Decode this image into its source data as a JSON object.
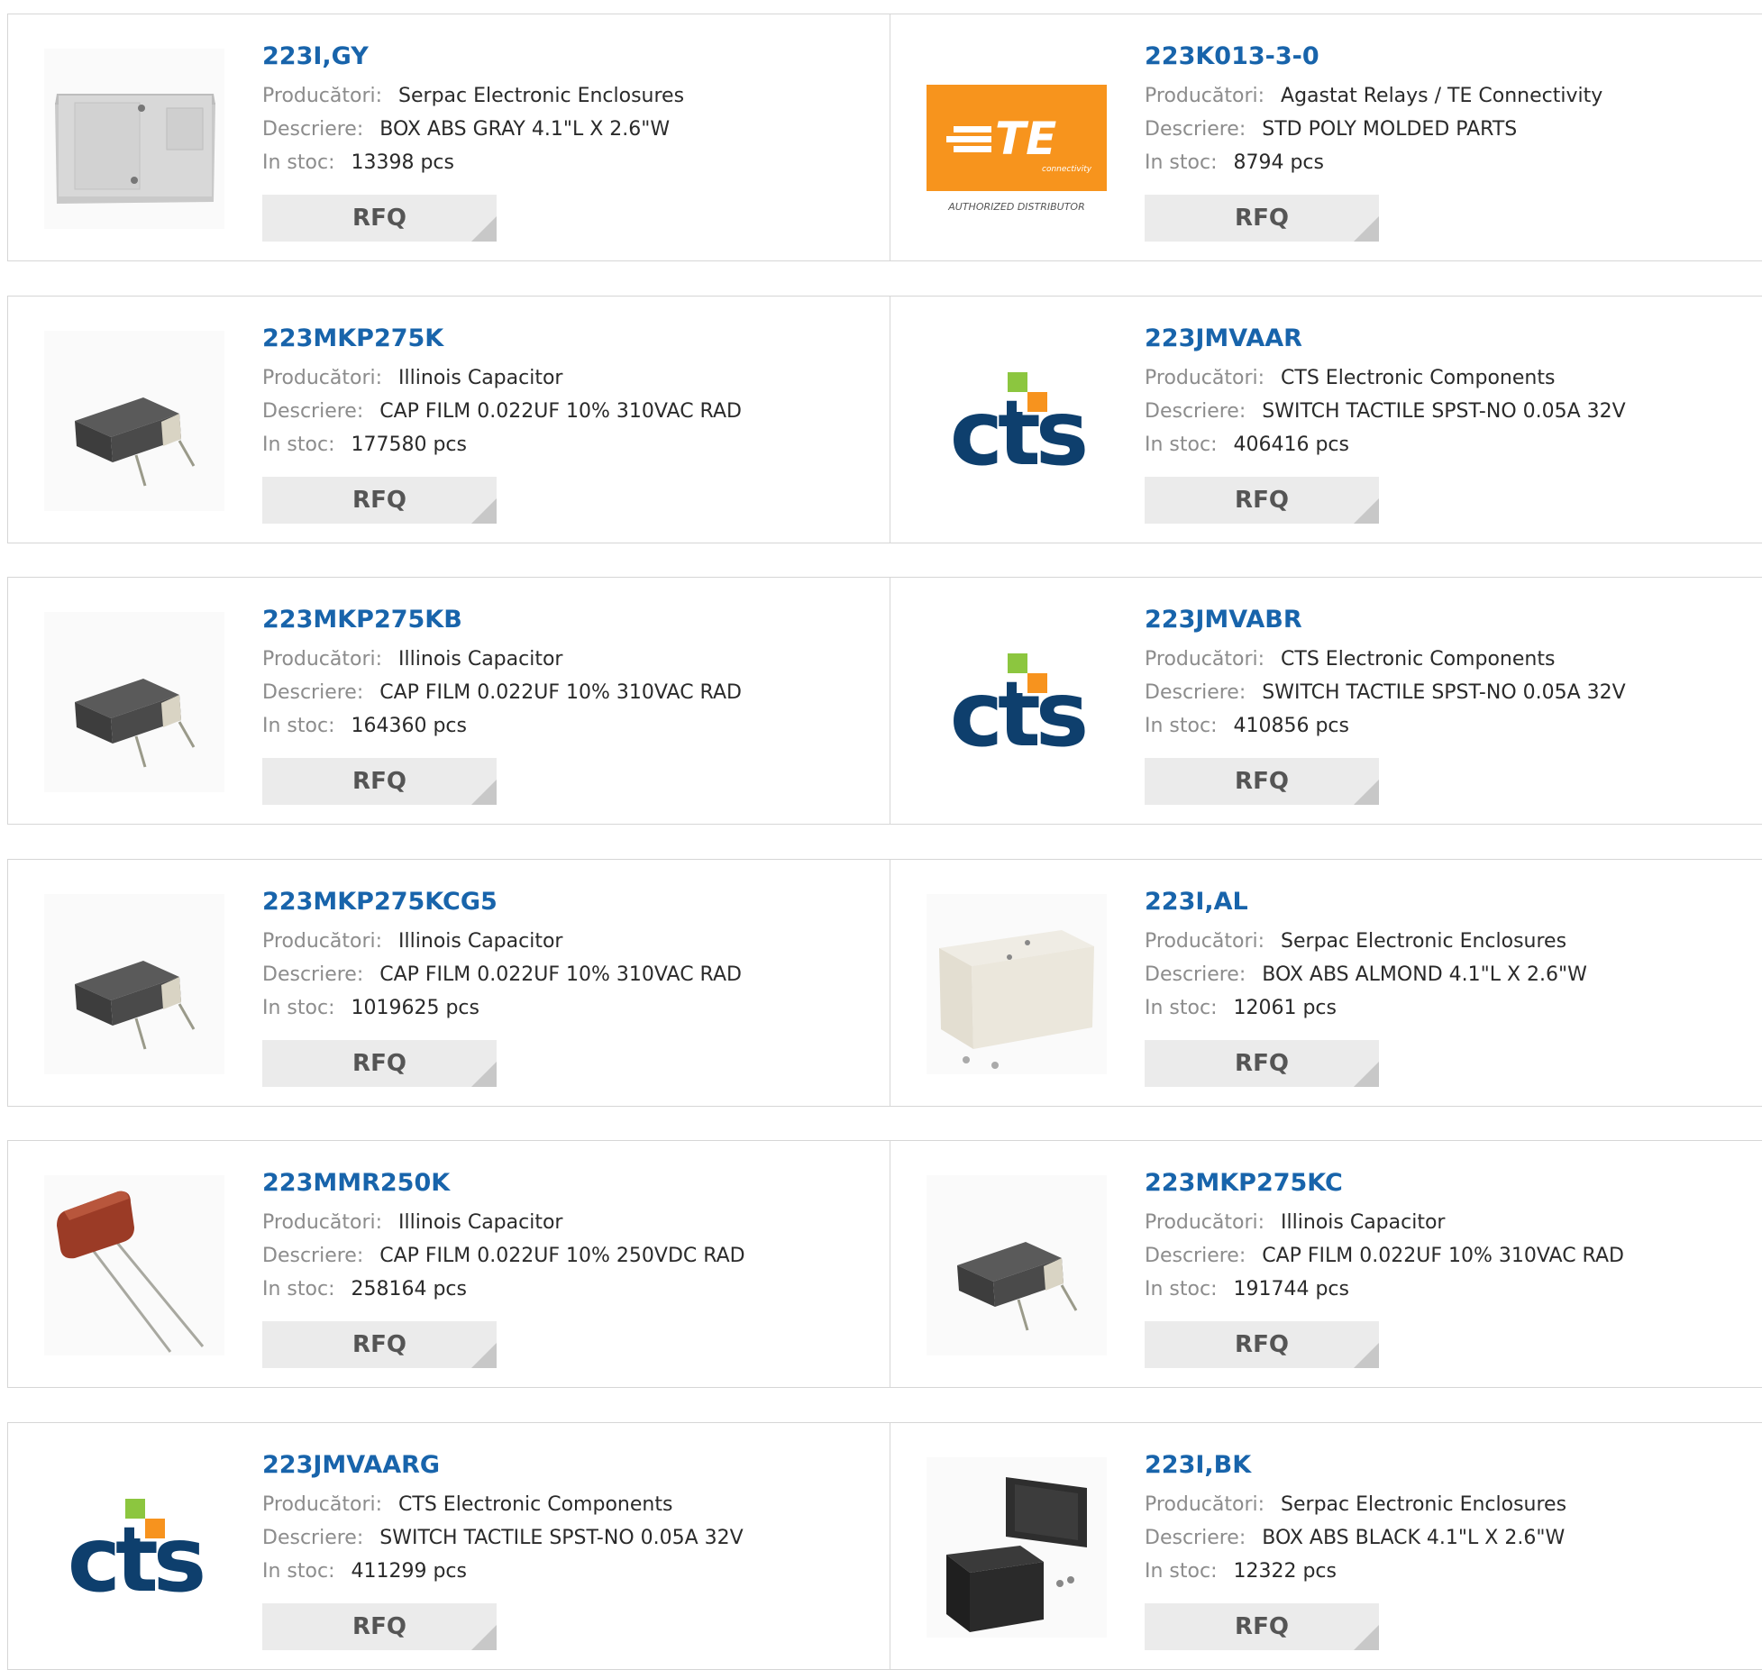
{
  "labels": {
    "manufacturer": "Producători:",
    "description": "Descriere:",
    "stock": "In stoc:",
    "rfq": "RFQ"
  },
  "products": [
    {
      "part": "223I,GY",
      "manufacturer": "Serpac Electronic Enclosures",
      "description": "BOX ABS GRAY 4.1\"L X 2.6\"W",
      "stock": "13398 pcs",
      "image": "gray-enclosure"
    },
    {
      "part": "223K013-3-0",
      "manufacturer": "Agastat Relays / TE Connectivity",
      "description": "STD POLY MOLDED PARTS",
      "stock": "8794 pcs",
      "image": "te-logo",
      "logo_text": {
        "brand": "TE",
        "sub": "connectivity",
        "caption": "AUTHORIZED DISTRIBUTOR"
      }
    },
    {
      "part": "223MKP275K",
      "manufacturer": "Illinois Capacitor",
      "description": "CAP FILM 0.022UF 10% 310VAC RAD",
      "stock": "177580 pcs",
      "image": "film-capacitor"
    },
    {
      "part": "223JMVAAR",
      "manufacturer": "CTS Electronic Components",
      "description": "SWITCH TACTILE SPST-NO 0.05A 32V",
      "stock": "406416 pcs",
      "image": "cts-logo"
    },
    {
      "part": "223MKP275KB",
      "manufacturer": "Illinois Capacitor",
      "description": "CAP FILM 0.022UF 10% 310VAC RAD",
      "stock": "164360 pcs",
      "image": "film-capacitor"
    },
    {
      "part": "223JMVABR",
      "manufacturer": "CTS Electronic Components",
      "description": "SWITCH TACTILE SPST-NO 0.05A 32V",
      "stock": "410856 pcs",
      "image": "cts-logo"
    },
    {
      "part": "223MKP275KCG5",
      "manufacturer": "Illinois Capacitor",
      "description": "CAP FILM 0.022UF 10% 310VAC RAD",
      "stock": "1019625 pcs",
      "image": "film-capacitor"
    },
    {
      "part": "223I,AL",
      "manufacturer": "Serpac Electronic Enclosures",
      "description": "BOX ABS ALMOND 4.1\"L X 2.6\"W",
      "stock": "12061 pcs",
      "image": "almond-enclosure"
    },
    {
      "part": "223MMR250K",
      "manufacturer": "Illinois Capacitor",
      "description": "CAP FILM 0.022UF 10% 250VDC RAD",
      "stock": "258164 pcs",
      "image": "red-capacitor"
    },
    {
      "part": "223MKP275KC",
      "manufacturer": "Illinois Capacitor",
      "description": "CAP FILM 0.022UF 10% 310VAC RAD",
      "stock": "191744 pcs",
      "image": "film-capacitor"
    },
    {
      "part": "223JMVAARG",
      "manufacturer": "CTS Electronic Components",
      "description": "SWITCH TACTILE SPST-NO 0.05A 32V",
      "stock": "411299 pcs",
      "image": "cts-logo"
    },
    {
      "part": "223I,BK",
      "manufacturer": "Serpac Electronic Enclosures",
      "description": "BOX ABS BLACK 4.1\"L X 2.6\"W",
      "stock": "12322 pcs",
      "image": "black-enclosure"
    }
  ],
  "colors": {
    "part_link": "#1864ab",
    "label": "#8c8c8c",
    "te_orange": "#f7941d",
    "cts_blue": "#0e3f6d",
    "cts_green": "#8cc63f",
    "cts_orange": "#f7931e"
  }
}
